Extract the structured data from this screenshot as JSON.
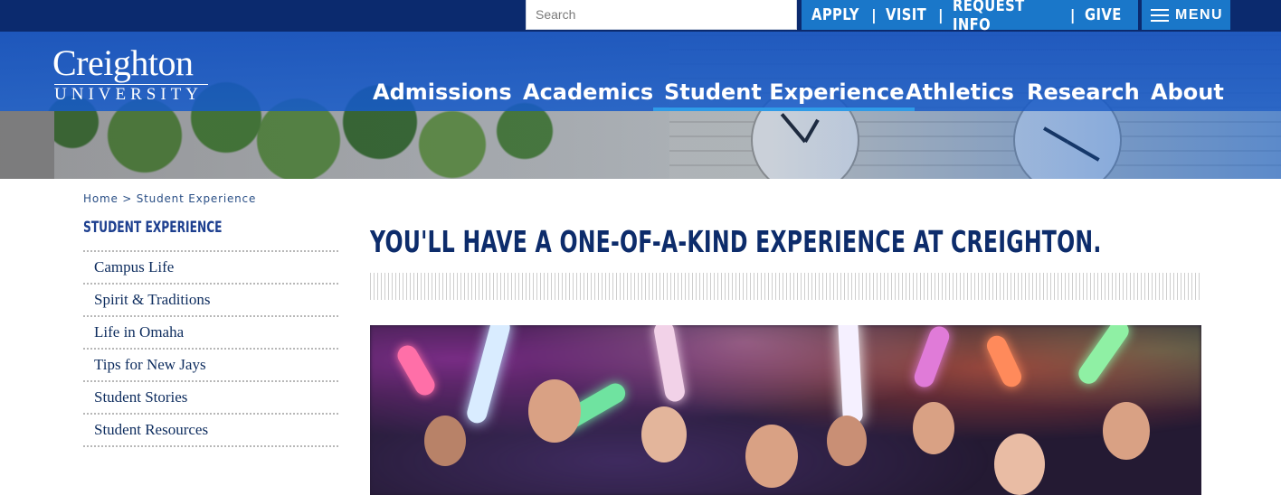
{
  "utility": {
    "search_placeholder": "Search",
    "quick_links": [
      "APPLY",
      "VISIT",
      "REQUEST INFO",
      "GIVE"
    ],
    "separator": "|",
    "menu_label": "MENU"
  },
  "logo": {
    "name": "Creighton",
    "subtitle": "UNIVERSITY"
  },
  "nav": {
    "items": [
      "Admissions",
      "Academics",
      "Student Experience",
      "Athletics",
      "Research",
      "About"
    ],
    "active": "Student Experience"
  },
  "breadcrumb": {
    "home": "Home",
    "separator": ">",
    "current": "Student Experience"
  },
  "sidebar": {
    "title": "STUDENT EXPERIENCE",
    "items": [
      "Campus Life",
      "Spirit & Traditions",
      "Life in Omaha",
      "Tips for New Jays",
      "Student Stories",
      "Student Resources"
    ]
  },
  "main": {
    "headline": "YOU'LL HAVE A ONE-OF-A-KIND EXPERIENCE AT CREIGHTON."
  },
  "colors": {
    "utility_bar": "#0b2a6e",
    "quick_links_bg": "#1a77c9",
    "nav_band": "#1250be",
    "active_underline": "#2f9be8",
    "headline": "#0d2c6b",
    "sidebar_title": "#1d3f8f"
  },
  "icons": {
    "menu": "hamburger-icon"
  }
}
